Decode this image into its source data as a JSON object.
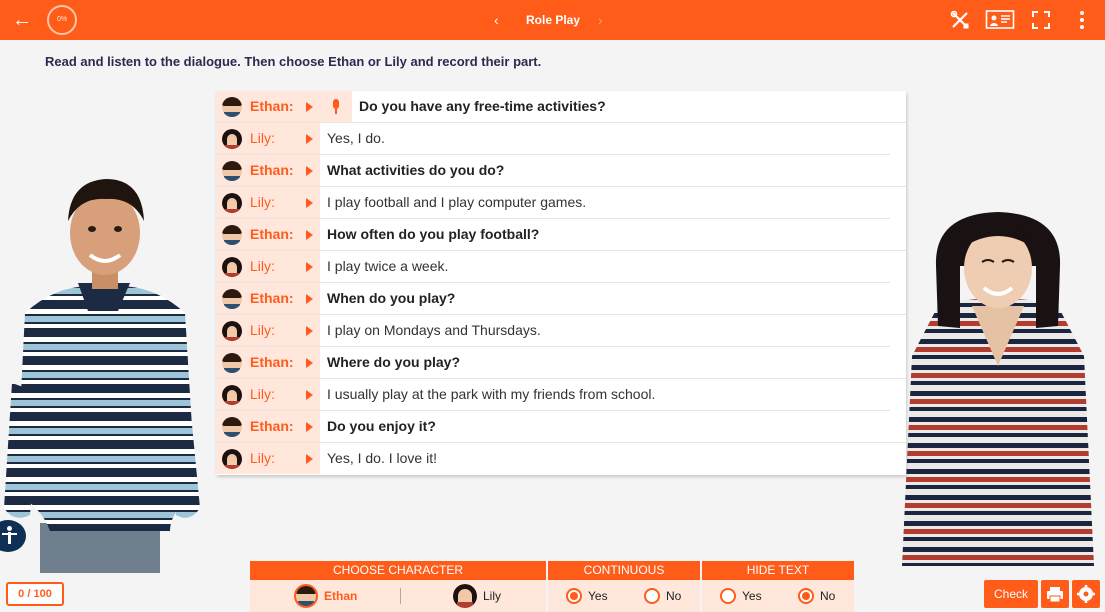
{
  "topbar": {
    "back_icon": "arrow-left-icon",
    "progress": "0%",
    "title": "Role Play",
    "prev_icon": "chevron-left-icon",
    "next_icon": "chevron-right-icon",
    "tools": [
      "tools-icon",
      "presentation-icon",
      "fullscreen-icon",
      "more-vert-icon"
    ]
  },
  "instruction": "Read and listen to the dialogue. Then choose Ethan or Lily and record their part.",
  "dialogue": [
    {
      "speaker": "Ethan:",
      "text": "Do you have any free-time activities?"
    },
    {
      "speaker": "Lily:",
      "text": "Yes, I do."
    },
    {
      "speaker": "Ethan:",
      "text": "What activities do you do?"
    },
    {
      "speaker": "Lily:",
      "text": "I play football and I play computer games."
    },
    {
      "speaker": "Ethan:",
      "text": "How often do you play football?"
    },
    {
      "speaker": "Lily:",
      "text": "I play twice a week."
    },
    {
      "speaker": "Ethan:",
      "text": "When do you play?"
    },
    {
      "speaker": "Lily:",
      "text": "I play on Mondays and Thursdays."
    },
    {
      "speaker": "Ethan:",
      "text": "Where do you play?"
    },
    {
      "speaker": "Lily:",
      "text": "I usually play at the park with my friends from school."
    },
    {
      "speaker": "Ethan:",
      "text": "Do you enjoy it?"
    },
    {
      "speaker": "Lily:",
      "text": "Yes, I do. I love it!"
    }
  ],
  "options": {
    "choose_character": {
      "header": "CHOOSE CHARACTER",
      "ethan": "Ethan",
      "lily": "Lily",
      "selected": "Ethan"
    },
    "continuous": {
      "header": "CONTINUOUS",
      "yes": "Yes",
      "no": "No",
      "selected": "Yes"
    },
    "hide_text": {
      "header": "HIDE TEXT",
      "yes": "Yes",
      "no": "No",
      "selected": "No"
    }
  },
  "score": "0 / 100",
  "footer": {
    "check_label": "Check",
    "print_icon": "print-icon",
    "settings_icon": "settings-icon"
  },
  "colors": {
    "accent": "#ff5c1a",
    "accent_light": "#ffe7dc",
    "background": "#f4f4f4",
    "instruction_text": "#2b2b4f"
  }
}
